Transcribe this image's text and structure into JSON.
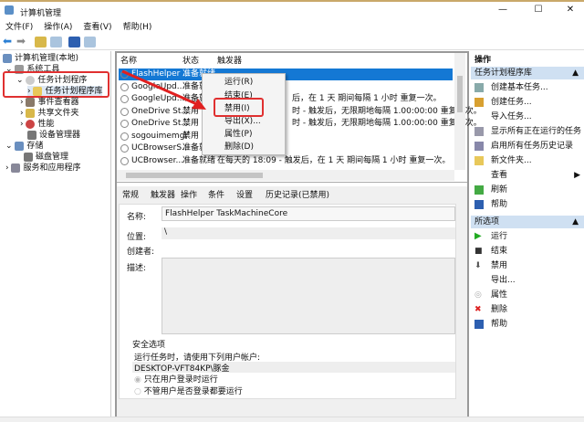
{
  "window": {
    "title": "计算机管理",
    "min": "—",
    "max": "☐",
    "close": "✕"
  },
  "menu": [
    "文件(F)",
    "操作(A)",
    "查看(V)",
    "帮助(H)"
  ],
  "tree": {
    "root": "计算机管理(本地)",
    "system_tools": "系统工具",
    "task_scheduler": "任务计划程序",
    "task_library": "任务计划程序库",
    "event_viewer": "事件查看器",
    "shared_folders": "共享文件夹",
    "performance": "性能",
    "device_manager": "设备管理器",
    "storage": "存储",
    "disk_mgmt": "磁盘管理",
    "services": "服务和应用程序"
  },
  "list": {
    "headers": {
      "name": "名称",
      "status": "状态",
      "trigger": "触发器"
    },
    "rows": [
      {
        "name": "FlashHelper ...",
        "status": "准备就绪",
        "trigger": ""
      },
      {
        "name": "GoogleUpd...",
        "status": "准备就绪",
        "trigger": ""
      },
      {
        "name": "GoogleUpd...",
        "status": "准备就绪",
        "trigger": "后，在 1 天 期间每隔 1 小时 重复一次。"
      },
      {
        "name": "OneDrive St...",
        "status": "禁用",
        "trigger": "时 - 触发后，无限期地每隔 1.00:00:00 重复一次。"
      },
      {
        "name": "OneDrive St...",
        "status": "禁用",
        "trigger": "时 - 触发后，无限期地每隔 1.00:00:00 重复一次。"
      },
      {
        "name": "sogouimemgr",
        "status": "禁用",
        "trigger": ""
      },
      {
        "name": "UCBrowserS...",
        "status": "准备就绪",
        "trigger": ""
      },
      {
        "name": "UCBrowser...",
        "status": "准备就绪",
        "trigger": "在每天的 18:09 - 触发后，在 1 天 期间每隔 1 小时 重复一次。"
      }
    ]
  },
  "context_menu": [
    "运行(R)",
    "结束(E)",
    "禁用(I)",
    "导出(X)...",
    "属性(P)",
    "删除(D)"
  ],
  "detail": {
    "tabs": [
      "常规",
      "触发器",
      "操作",
      "条件",
      "设置",
      "历史记录(已禁用)"
    ],
    "name_label": "名称:",
    "name_value": "FlashHelper TaskMachineCore",
    "location_label": "位置:",
    "location_value": "\\",
    "author_label": "创建者:",
    "desc_label": "描述:",
    "security_title": "安全选项",
    "run_as_label": "运行任务时，请使用下列用户帐户:",
    "account": "DESKTOP-VFT84KP\\豚金",
    "radio1": "只在用户登录时运行",
    "radio2": "不管用户是否登录都要运行"
  },
  "actions": {
    "title": "操作",
    "section1": "任务计划程序库",
    "items1": [
      "创建基本任务...",
      "创建任务...",
      "导入任务...",
      "显示所有正在运行的任务",
      "启用所有任务历史记录",
      "新文件夹...",
      "查看",
      "刷新",
      "帮助"
    ],
    "section2": "所选项",
    "items2": [
      "运行",
      "结束",
      "禁用",
      "导出...",
      "属性",
      "删除",
      "帮助"
    ]
  }
}
